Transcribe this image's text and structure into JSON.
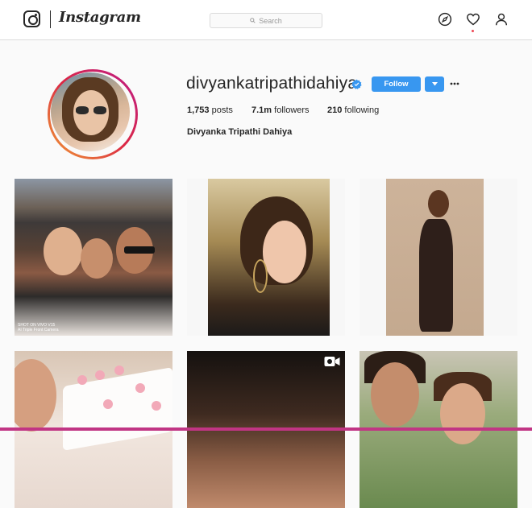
{
  "header": {
    "brand": "Instagram",
    "search_placeholder": "Search",
    "icons": [
      "instagram-glyph-icon",
      "explore-compass-icon",
      "activity-heart-icon",
      "profile-person-icon"
    ]
  },
  "profile": {
    "username": "divyankatripathidahiya",
    "verified": true,
    "follow_label": "Follow",
    "posts_count": "1,753",
    "posts_label": "posts",
    "followers_count": "7.1m",
    "followers_label": "followers",
    "following_count": "210",
    "following_label": "following",
    "full_name": "Divyanka Tripathi Dahiya"
  },
  "grid": {
    "watermark_line1": "SHOT ON VIVO V15",
    "watermark_line2": "AI Triple Front Camera"
  },
  "colors": {
    "accent": "#3897f0",
    "story_ring": "#dc2743",
    "notification": "#ed4956",
    "text": "#262626",
    "border": "#dbdbdb"
  }
}
